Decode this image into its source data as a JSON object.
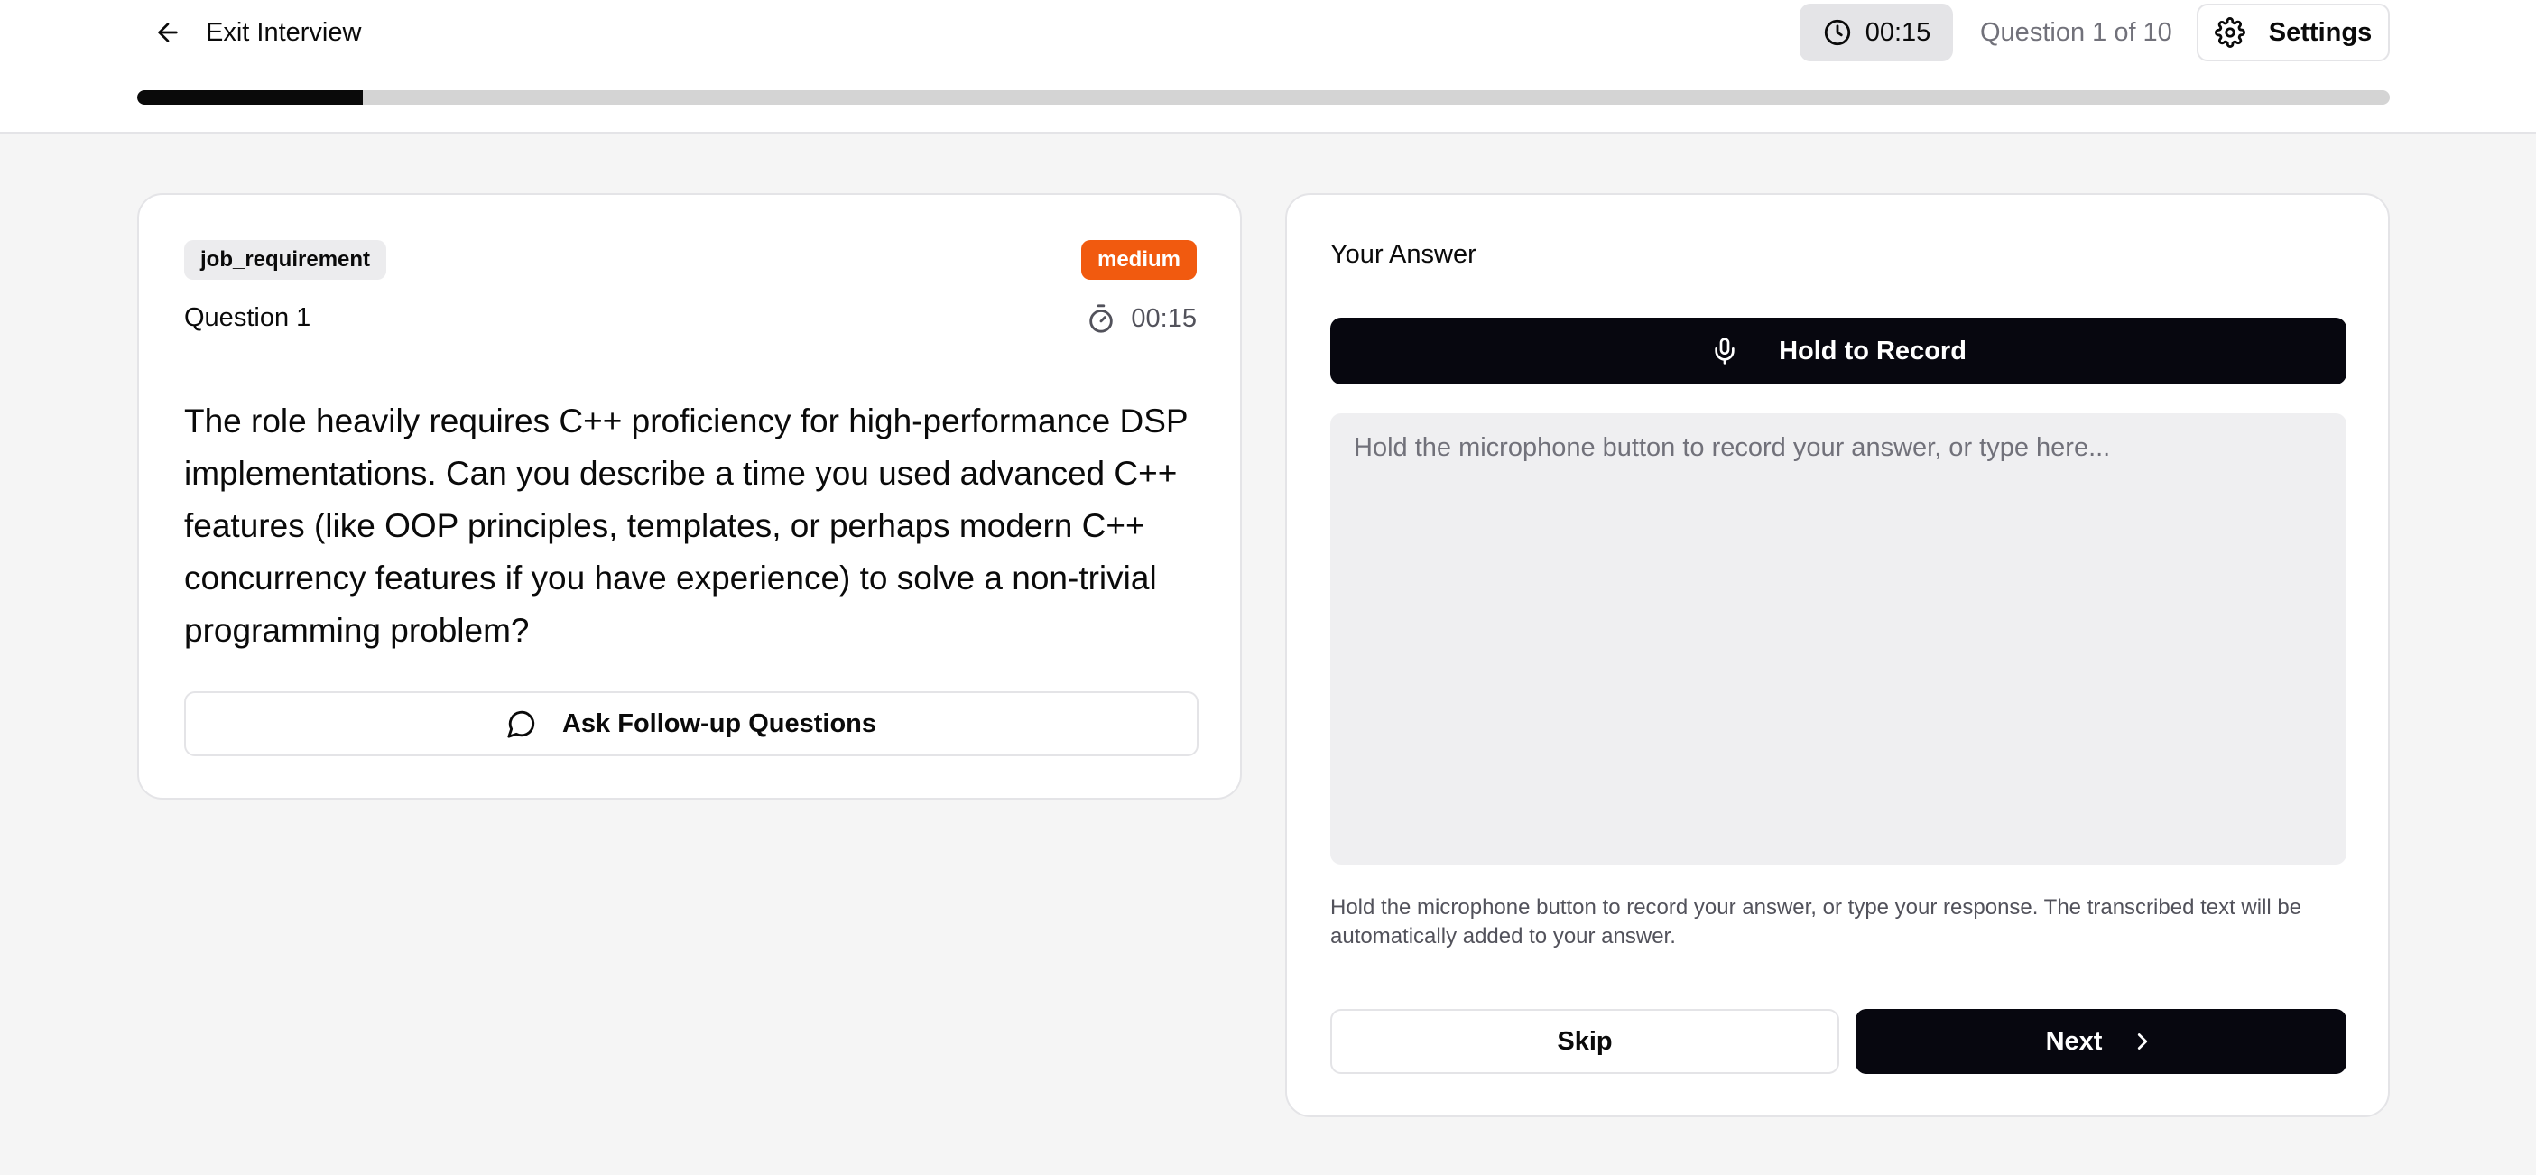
{
  "header": {
    "exit_label": "Exit Interview",
    "timer": "00:15",
    "question_counter": "Question 1 of 10",
    "settings_label": "Settings",
    "progress_fraction": 0.1
  },
  "question_card": {
    "category_tag": "job_requirement",
    "difficulty_badge": "medium",
    "title": "Question 1",
    "timer": "00:15",
    "text": "The role heavily requires C++ proficiency for high-performance DSP implementations. Can you describe a time you used advanced C++ features (like OOP principles, templates, or perhaps modern C++ concurrency features if you have experience) to solve a non-trivial programming problem?",
    "follow_up_label": "Ask Follow-up Questions"
  },
  "answer_card": {
    "title": "Your Answer",
    "record_label": "Hold to Record",
    "answer_value": "",
    "answer_placeholder": "Hold the microphone button to record your answer, or type here...",
    "hint": "Hold the microphone button to record your answer, or type your response. The transcribed text will be automatically added to your answer.",
    "skip_label": "Skip",
    "next_label": "Next"
  },
  "colors": {
    "accent_dark": "#07070f",
    "badge_orange": "#f15a0f",
    "background": "#f5f5f5"
  },
  "icons": {
    "exit": "arrow-left-icon",
    "timer": "clock-icon",
    "settings": "gear-icon",
    "question_timer": "stopwatch-icon",
    "follow_up": "chat-bubble-icon",
    "record": "microphone-icon",
    "next": "chevron-right-icon"
  }
}
